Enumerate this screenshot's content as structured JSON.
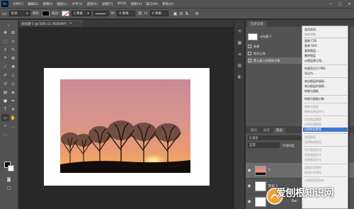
{
  "menubar": {
    "app_logo": "Ps",
    "items": [
      "文件(F)",
      "编辑(E)",
      "图像(I)",
      "图层(L)",
      "文字(Y)",
      "选择(S)",
      "滤镜(T)",
      "3D(D)",
      "视图(V)",
      "窗口(W)",
      "帮助(H)"
    ],
    "window_controls": [
      "—",
      "□",
      "✕"
    ]
  },
  "optionsbar": {
    "shape_mode": "形状",
    "fill_label": "填充:",
    "stroke_label": "描边:",
    "stroke_width": "1 像素",
    "w_label": "W:",
    "w_value": "0 像素",
    "h_label": "H:",
    "h_value": "0 像素"
  },
  "document": {
    "tab_title": "未标题-1 @ 50% (2, RGB/8#)",
    "tab_close": "×"
  },
  "history_panel": {
    "tabs": [
      "历史记录"
    ],
    "snapshot_label": "未标题-1",
    "rows": [
      "新建",
      "矩形工具",
      "置入嵌入的智能对象"
    ]
  },
  "layers_panel": {
    "tabs": [
      "路径",
      "通道",
      "图层"
    ],
    "filter_label": "Q 类型",
    "blend_mode": "正常",
    "opacity_label": "不透明度",
    "layers": [
      {
        "name": "2",
        "selected": true
      },
      {
        "name": "矩形 1",
        "selected": false
      },
      {
        "name": "背景",
        "selected": false
      }
    ]
  },
  "context_menu": {
    "items": [
      {
        "label": "混合选项...",
        "state": "normal"
      },
      {
        "label": "编辑调整...",
        "state": "disabled"
      },
      {
        "label": "复制 CSS",
        "state": "normal"
      },
      {
        "label": "复制 SVG",
        "state": "normal"
      },
      {
        "label": "复制图层...",
        "state": "normal"
      },
      {
        "label": "删除图层",
        "state": "normal"
      },
      {
        "label": "从图层建立组...",
        "state": "normal"
      },
      {
        "label": "快速导出为 PNG",
        "state": "normal"
      },
      {
        "label": "导出为...",
        "state": "normal"
      },
      {
        "label": "来自图层的画板...",
        "state": "normal"
      },
      {
        "label": "来自图层的画框...",
        "state": "normal"
      },
      {
        "label": "转换为图框",
        "state": "normal"
      },
      {
        "label": "转换为智能对象",
        "state": "normal"
      },
      {
        "label": "栅格化图层",
        "state": "disabled"
      },
      {
        "label": "栅格化图层样式",
        "state": "disabled"
      },
      {
        "label": "启用图层蒙版",
        "state": "disabled"
      },
      {
        "label": "启用矢量蒙版",
        "state": "disabled"
      },
      {
        "label": "创建剪贴蒙版",
        "state": "highlighted"
      },
      {
        "label": "链接图层",
        "state": "disabled"
      },
      {
        "label": "选择链接图层",
        "state": "disabled"
      },
      {
        "label": "拷贝图层样式",
        "state": "disabled"
      },
      {
        "label": "粘贴图层样式",
        "state": "disabled"
      },
      {
        "label": "清除图层样式",
        "state": "disabled"
      },
      {
        "label": "复制形状属性",
        "state": "disabled"
      },
      {
        "label": "粘贴形状属性",
        "state": "disabled"
      },
      {
        "label": "从隔离图层释放",
        "state": "disabled"
      }
    ]
  },
  "watermark": {
    "text": "爱刨根知识网",
    "sub": "Bai"
  }
}
